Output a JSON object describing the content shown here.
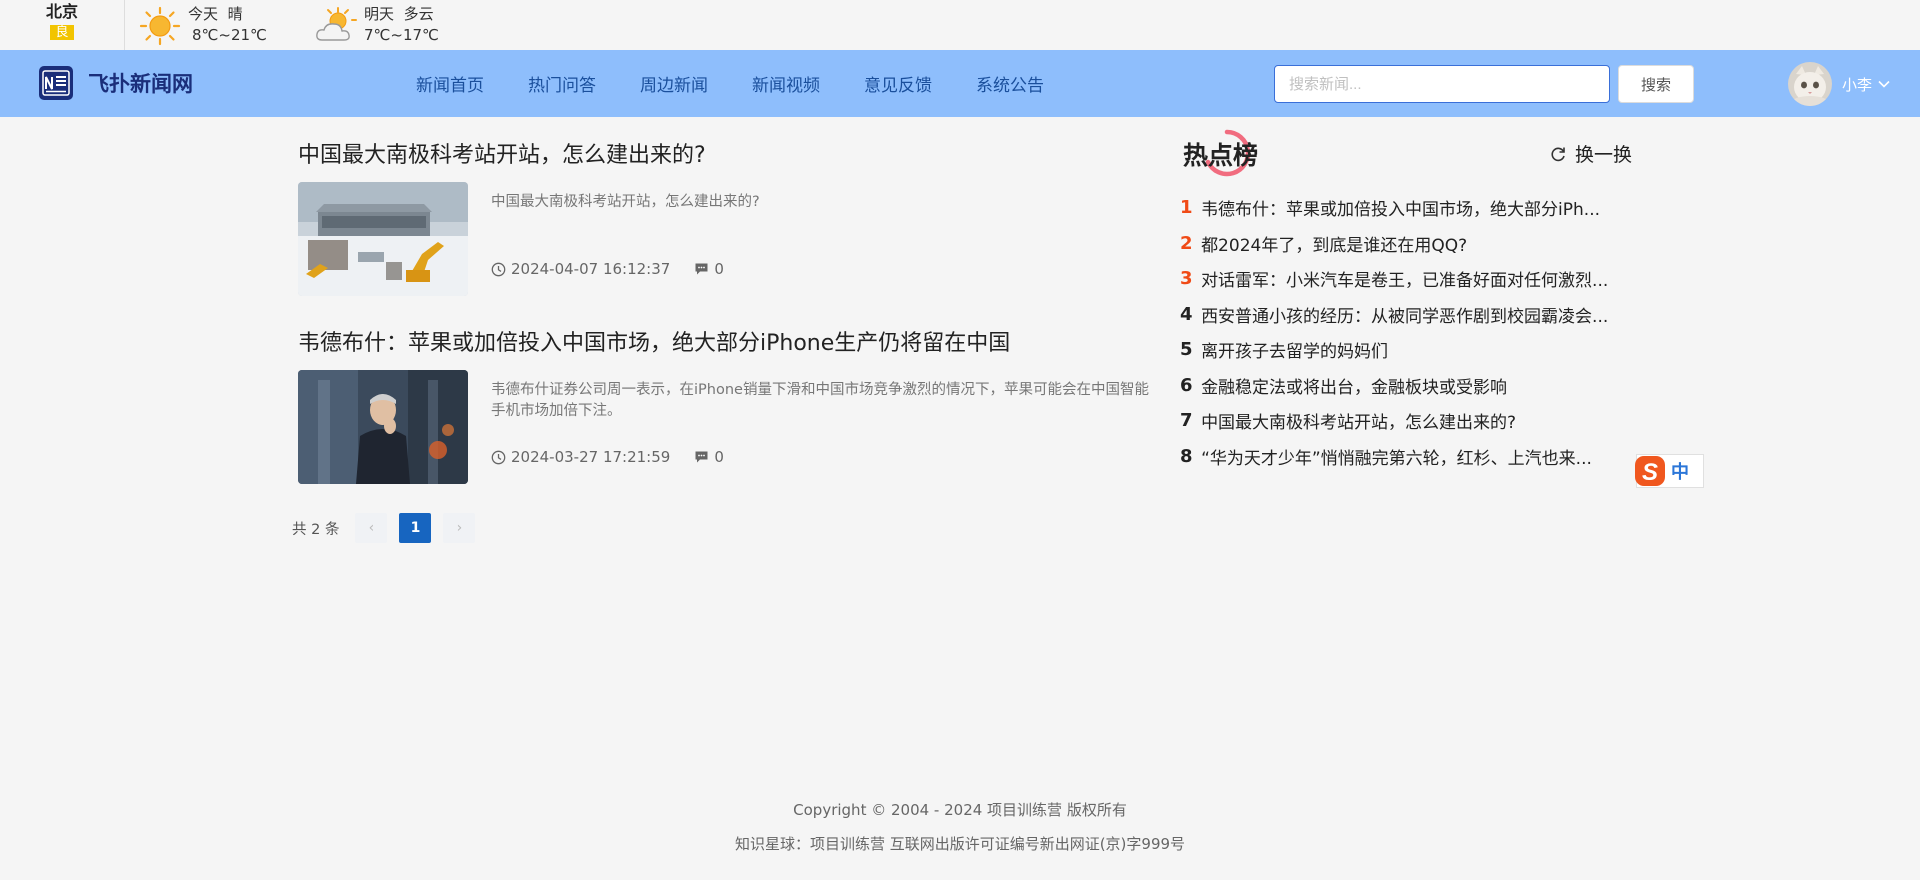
{
  "weather": {
    "city": "北京",
    "aqi": "良",
    "today": {
      "label": "今天",
      "condition": "晴",
      "temp": "8℃~21℃"
    },
    "tomorrow": {
      "label": "明天",
      "condition": "多云",
      "temp": "7℃~17℃"
    }
  },
  "header": {
    "site_name": "飞扑新闻网",
    "nav": [
      "新闻首页",
      "热门问答",
      "周边新闻",
      "新闻视频",
      "意见反馈",
      "系统公告"
    ],
    "search_placeholder": "搜索新闻...",
    "search_value": "",
    "search_button": "搜索",
    "username": "小李"
  },
  "articles": [
    {
      "title": "中国最大南极科考站开站，怎么建出来的?",
      "summary": "中国最大南极科考站开站，怎么建出来的?",
      "time": "2024-04-07 16:12:37",
      "comments": "0"
    },
    {
      "title": "韦德布什：苹果或加倍投入中国市场，绝大部分iPhone生产仍将留在中国",
      "summary": "韦德布什证券公司周一表示，在iPhone销量下滑和中国市场竞争激烈的情况下，苹果可能会在中国智能手机市场加倍下注。",
      "time": "2024-03-27 17:21:59",
      "comments": "0"
    }
  ],
  "pagination": {
    "total": "共 2 条",
    "current": "1",
    "prev": "‹",
    "next": "›"
  },
  "hot": {
    "title": "热点榜",
    "refresh": "换一换",
    "items": [
      {
        "rank": "1",
        "text": "韦德布什：苹果或加倍投入中国市场，绝大部分iPh..."
      },
      {
        "rank": "2",
        "text": "都2024年了，到底是谁还在用QQ?"
      },
      {
        "rank": "3",
        "text": "对话雷军：小米汽车是卷王，已准备好面对任何激烈..."
      },
      {
        "rank": "4",
        "text": "西安普通小孩的经历：从被同学恶作剧到校园霸凌会..."
      },
      {
        "rank": "5",
        "text": "离开孩子去留学的妈妈们"
      },
      {
        "rank": "6",
        "text": "金融稳定法或将出台，金融板块或受影响"
      },
      {
        "rank": "7",
        "text": "中国最大南极科考站开站，怎么建出来的?"
      },
      {
        "rank": "8",
        "text": "“华为天才少年”悄悄融完第六轮，红杉、上汽也来..."
      }
    ]
  },
  "ime": {
    "char": "中"
  },
  "footer": {
    "copyright": "Copyright © 2004 - 2024 项目训练营 版权所有",
    "license": "知识星球：项目训练营 互联网出版许可证编号新出网证(京)字999号"
  },
  "colors": {
    "nav_bg": "#8ebefc",
    "accent": "#1765c0",
    "hot_rank": "#f04a16",
    "aqi": "#f2c400"
  },
  "icons": [
    "sun-icon",
    "partly-cloudy-icon",
    "newspaper-logo-icon",
    "chevron-down-icon",
    "clock-icon",
    "comment-icon",
    "refresh-icon",
    "ime-sogou-icon"
  ]
}
